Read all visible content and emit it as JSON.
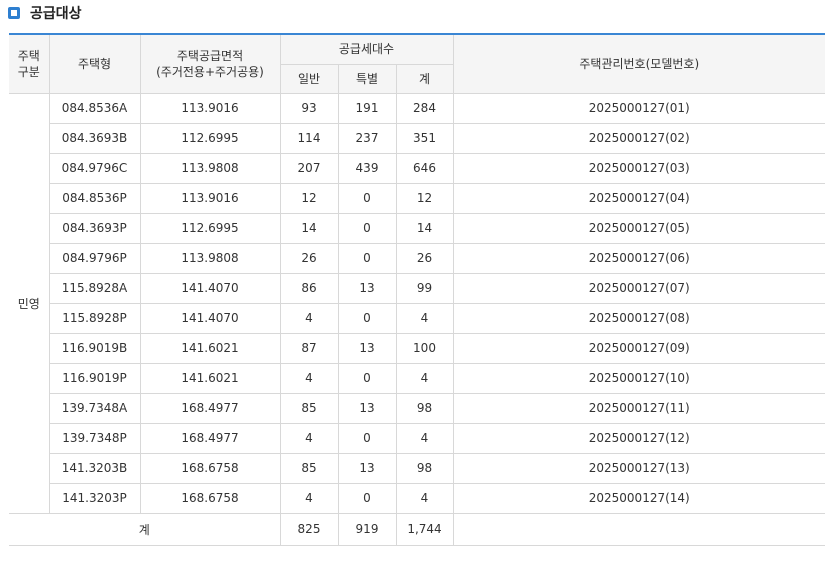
{
  "section": {
    "title": "공급대상",
    "icon": "square-bullet-icon",
    "accent": "#2e7fd0"
  },
  "table": {
    "headers": {
      "category_line1": "주택",
      "category_line2": "구분",
      "type": "주택형",
      "area_line1": "주택공급면적",
      "area_line2": "(주거전용+주거공용)",
      "households": "공급세대수",
      "general": "일반",
      "special": "특별",
      "total": "계",
      "mgmt_no": "주택관리번호(모델번호)"
    },
    "category": "민영",
    "rows": [
      {
        "type": "084.8536A",
        "area": "113.9016",
        "general": "93",
        "special": "191",
        "total": "284",
        "mgmt_no": "2025000127(01)"
      },
      {
        "type": "084.3693B",
        "area": "112.6995",
        "general": "114",
        "special": "237",
        "total": "351",
        "mgmt_no": "2025000127(02)"
      },
      {
        "type": "084.9796C",
        "area": "113.9808",
        "general": "207",
        "special": "439",
        "total": "646",
        "mgmt_no": "2025000127(03)"
      },
      {
        "type": "084.8536P",
        "area": "113.9016",
        "general": "12",
        "special": "0",
        "total": "12",
        "mgmt_no": "2025000127(04)"
      },
      {
        "type": "084.3693P",
        "area": "112.6995",
        "general": "14",
        "special": "0",
        "total": "14",
        "mgmt_no": "2025000127(05)"
      },
      {
        "type": "084.9796P",
        "area": "113.9808",
        "general": "26",
        "special": "0",
        "total": "26",
        "mgmt_no": "2025000127(06)"
      },
      {
        "type": "115.8928A",
        "area": "141.4070",
        "general": "86",
        "special": "13",
        "total": "99",
        "mgmt_no": "2025000127(07)"
      },
      {
        "type": "115.8928P",
        "area": "141.4070",
        "general": "4",
        "special": "0",
        "total": "4",
        "mgmt_no": "2025000127(08)"
      },
      {
        "type": "116.9019B",
        "area": "141.6021",
        "general": "87",
        "special": "13",
        "total": "100",
        "mgmt_no": "2025000127(09)"
      },
      {
        "type": "116.9019P",
        "area": "141.6021",
        "general": "4",
        "special": "0",
        "total": "4",
        "mgmt_no": "2025000127(10)"
      },
      {
        "type": "139.7348A",
        "area": "168.4977",
        "general": "85",
        "special": "13",
        "total": "98",
        "mgmt_no": "2025000127(11)"
      },
      {
        "type": "139.7348P",
        "area": "168.4977",
        "general": "4",
        "special": "0",
        "total": "4",
        "mgmt_no": "2025000127(12)"
      },
      {
        "type": "141.3203B",
        "area": "168.6758",
        "general": "85",
        "special": "13",
        "total": "98",
        "mgmt_no": "2025000127(13)"
      },
      {
        "type": "141.3203P",
        "area": "168.6758",
        "general": "4",
        "special": "0",
        "total": "4",
        "mgmt_no": "2025000127(14)"
      }
    ],
    "summary": {
      "label": "계",
      "general": "825",
      "special": "919",
      "total": "1,744",
      "mgmt_no": ""
    }
  }
}
